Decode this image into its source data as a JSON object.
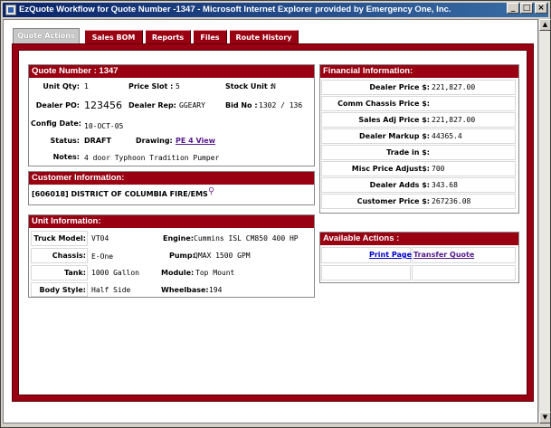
{
  "window": {
    "title": "EzQuote Workflow for Quote Number -1347 - Microsoft Internet Explorer provided by Emergency One, Inc."
  },
  "tabs": [
    {
      "label": "Quote Actions"
    },
    {
      "label": "Sales BOM"
    },
    {
      "label": "Reports"
    },
    {
      "label": "Files"
    },
    {
      "label": "Route History"
    }
  ],
  "quote": {
    "header": "Quote Number : 1347",
    "unit_qty_label": "Unit Qty:",
    "unit_qty": "1",
    "price_slot_label": "Price Slot :",
    "price_slot": "5",
    "stock_unit_label": "Stock Unit :",
    "stock_unit": "N",
    "dealer_po_label": "Dealer PO:",
    "dealer_po": "123456",
    "dealer_rep_label": "Dealer Rep:",
    "dealer_rep": "GGEARY",
    "bid_no_label": "Bid No :",
    "bid_no": "1302 / 136",
    "config_date_label": "Config Date:",
    "config_date": "10-OCT-05",
    "status_label": "Status:",
    "status": "DRAFT",
    "drawing_label": "Drawing:",
    "drawing_link": "PE 4 View",
    "notes_label": "Notes:",
    "notes": "4 door Typhoon Tradition Pumper"
  },
  "customer": {
    "header": "Customer Information:",
    "name": "[606018] DISTRICT OF COLUMBIA FIRE/EMS"
  },
  "unit": {
    "header": "Unit Information:",
    "truck_model_label": "Truck Model:",
    "truck_model": "VT04",
    "engine_label": "Engine:",
    "engine": "Cummins ISL CM850 400 HP",
    "chassis_label": "Chassis:",
    "chassis": "E-One",
    "pump_label": "Pump:",
    "pump": "QMAX 1500 GPM",
    "tank_label": "Tank:",
    "tank": "1000 Gallon",
    "module_label": "Module:",
    "module": "Top Mount",
    "body_style_label": "Body Style:",
    "body_style": "Half Side",
    "wheelbase_label": "Wheelbase:",
    "wheelbase": "194"
  },
  "financial": {
    "header": "Financial Information:",
    "rows": [
      {
        "label": "Dealer Price $:",
        "value": "221,827.00"
      },
      {
        "label": "Comm Chassis Price $:",
        "value": ""
      },
      {
        "label": "Sales Adj Price $:",
        "value": "221,827.00"
      },
      {
        "label": "Dealer Markup $:",
        "value": "44365.4"
      },
      {
        "label": "Trade in $:",
        "value": ""
      },
      {
        "label": "Misc Price Adjust$:",
        "value": "700"
      },
      {
        "label": "Dealer Adds $:",
        "value": "343.68"
      },
      {
        "label": "Customer Price $:",
        "value": "267236.08"
      }
    ]
  },
  "actions": {
    "header": "Available Actions :",
    "print_page": "Print Page",
    "transfer_quote": "Transfer Quote"
  }
}
